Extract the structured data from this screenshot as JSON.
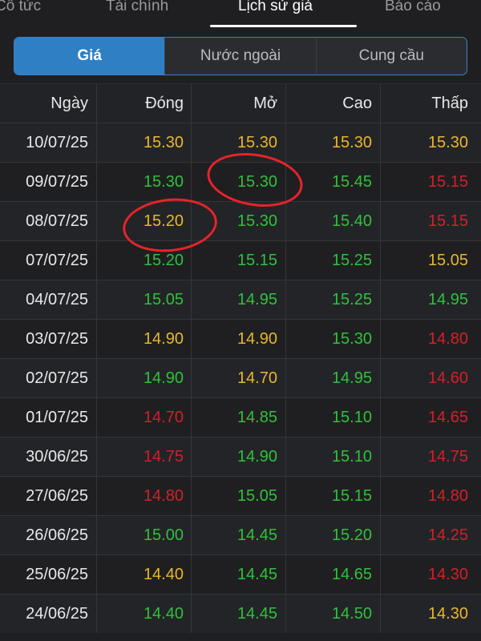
{
  "top_tabs": [
    {
      "label": "Cổ tức"
    },
    {
      "label": "Tài chính"
    },
    {
      "label": "Lịch sử giá"
    },
    {
      "label": "Báo cáo"
    }
  ],
  "segments": [
    {
      "label": "Giá"
    },
    {
      "label": "Nước ngoài"
    },
    {
      "label": "Cung cầu"
    }
  ],
  "table": {
    "headers": [
      "Ngày",
      "Đóng",
      "Mở",
      "Cao",
      "Thấp"
    ],
    "rows": [
      {
        "date": "10/07/25",
        "close": "15.30",
        "open": "15.30",
        "high": "15.30",
        "low": "15.30",
        "colors": [
          "yellow",
          "yellow",
          "yellow",
          "yellow"
        ]
      },
      {
        "date": "09/07/25",
        "close": "15.30",
        "open": "15.30",
        "high": "15.45",
        "low": "15.15",
        "colors": [
          "green",
          "green",
          "green",
          "red"
        ]
      },
      {
        "date": "08/07/25",
        "close": "15.20",
        "open": "15.30",
        "high": "15.40",
        "low": "15.15",
        "colors": [
          "yellow",
          "green",
          "green",
          "red"
        ]
      },
      {
        "date": "07/07/25",
        "close": "15.20",
        "open": "15.15",
        "high": "15.25",
        "low": "15.05",
        "colors": [
          "green",
          "green",
          "green",
          "yellow"
        ]
      },
      {
        "date": "04/07/25",
        "close": "15.05",
        "open": "14.95",
        "high": "15.25",
        "low": "14.95",
        "colors": [
          "green",
          "green",
          "green",
          "green"
        ]
      },
      {
        "date": "03/07/25",
        "close": "14.90",
        "open": "14.90",
        "high": "15.30",
        "low": "14.80",
        "colors": [
          "yellow",
          "yellow",
          "green",
          "red"
        ]
      },
      {
        "date": "02/07/25",
        "close": "14.90",
        "open": "14.70",
        "high": "14.95",
        "low": "14.60",
        "colors": [
          "green",
          "yellow",
          "green",
          "red"
        ]
      },
      {
        "date": "01/07/25",
        "close": "14.70",
        "open": "14.85",
        "high": "15.10",
        "low": "14.65",
        "colors": [
          "red",
          "green",
          "green",
          "red"
        ]
      },
      {
        "date": "30/06/25",
        "close": "14.75",
        "open": "14.90",
        "high": "15.10",
        "low": "14.75",
        "colors": [
          "red",
          "green",
          "green",
          "red"
        ]
      },
      {
        "date": "27/06/25",
        "close": "14.80",
        "open": "15.05",
        "high": "15.15",
        "low": "14.80",
        "colors": [
          "red",
          "green",
          "green",
          "red"
        ]
      },
      {
        "date": "26/06/25",
        "close": "15.00",
        "open": "14.45",
        "high": "15.20",
        "low": "14.25",
        "colors": [
          "green",
          "green",
          "green",
          "red"
        ]
      },
      {
        "date": "25/06/25",
        "close": "14.40",
        "open": "14.45",
        "high": "14.65",
        "low": "14.30",
        "colors": [
          "yellow",
          "green",
          "green",
          "red"
        ]
      },
      {
        "date": "24/06/25",
        "close": "14.40",
        "open": "14.45",
        "high": "14.50",
        "low": "14.30",
        "colors": [
          "green",
          "green",
          "green",
          "yellow"
        ]
      }
    ]
  },
  "colors": {
    "yellow": "#e9b72b",
    "green": "#2fc13c",
    "red": "#d2202a",
    "accent": "#2f7fc4"
  }
}
